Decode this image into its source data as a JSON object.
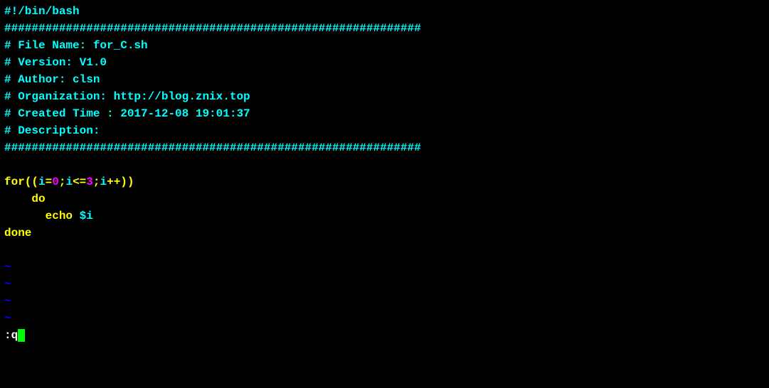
{
  "lines": {
    "shebang": "#!/bin/bash",
    "hashline": "#############################################################",
    "filename": "# File Name: for_C.sh",
    "version": "# Version: V1.0",
    "author": "# Author: clsn",
    "organization": "# Organization: http://blog.znix.top",
    "created": "# Created Time : 2017-12-08 19:01:37",
    "description": "# Description:",
    "for_kw": "for((",
    "for_var1": "i",
    "for_eq": "=",
    "for_zero": "0",
    "for_semi1": ";",
    "for_var2": "i",
    "for_lte": "<=",
    "for_three": "3",
    "for_semi2": ";",
    "for_var3": "i",
    "for_inc": "++",
    "for_close": "))",
    "do_indent": "    ",
    "do_kw": "do",
    "echo_indent": "      ",
    "echo_kw": "echo",
    "echo_sp": " ",
    "echo_var": "$i",
    "done_kw": "done",
    "tilde": "~",
    "cmd_colon": ":",
    "cmd_q": "q"
  }
}
